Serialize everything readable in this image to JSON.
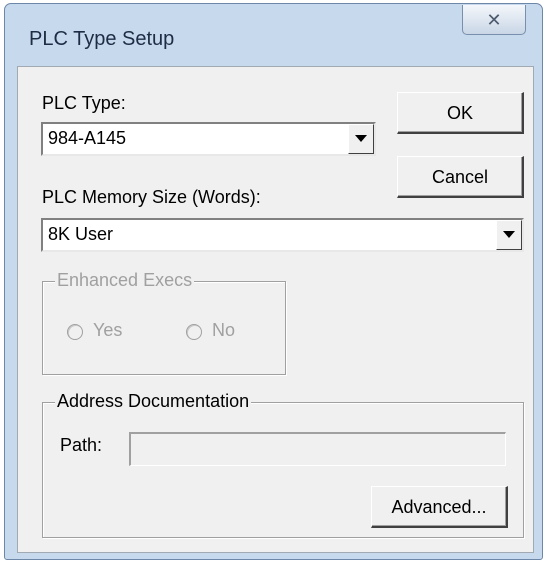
{
  "window": {
    "title": "PLC Type Setup",
    "close_icon": "close-icon"
  },
  "plc_type": {
    "label": "PLC Type:",
    "value": "984-A145"
  },
  "memory_size": {
    "label": "PLC Memory Size (Words):",
    "value": "8K User"
  },
  "buttons": {
    "ok": "OK",
    "cancel": "Cancel",
    "advanced": "Advanced..."
  },
  "enhanced_execs": {
    "title": "Enhanced Execs",
    "options": [
      {
        "label": "Yes"
      },
      {
        "label": "No"
      }
    ],
    "enabled": false
  },
  "address_documentation": {
    "title": "Address Documentation",
    "path_label": "Path:",
    "path_value": ""
  }
}
